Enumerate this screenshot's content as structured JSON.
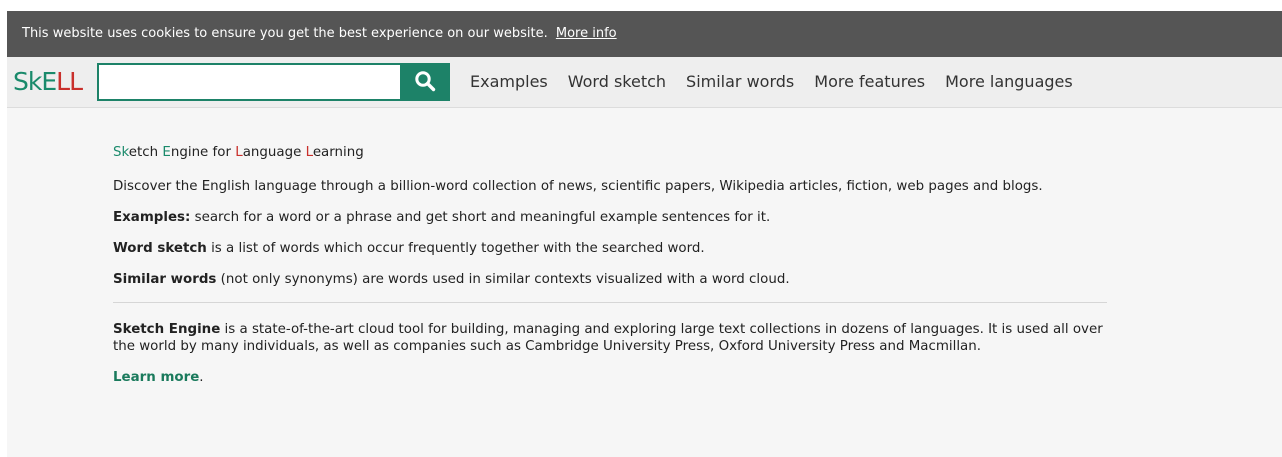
{
  "cookie_bar": {
    "message": "This website uses cookies to ensure you get the best experience on our website.",
    "more_info_label": "More info"
  },
  "header": {
    "logo": {
      "s": "S",
      "k": "k",
      "e": "E",
      "l1": "L",
      "l2": "L"
    },
    "search": {
      "value": "",
      "placeholder": ""
    },
    "search_button_icon": "search-icon",
    "nav": [
      {
        "label": "Examples"
      },
      {
        "label": "Word sketch"
      },
      {
        "label": "Similar words"
      },
      {
        "label": "More features"
      },
      {
        "label": "More languages"
      }
    ]
  },
  "main": {
    "tagline": {
      "w1_initial": "Sk",
      "w1_rest": "etch ",
      "w2_initial": "E",
      "w2_rest": "ngine for ",
      "w3_initial": "L",
      "w3_rest": "anguage ",
      "w4_initial": "L",
      "w4_rest": "earning"
    },
    "intro": "Discover the English language through a billion-word collection of news, scientific papers, Wikipedia articles, fiction, web pages and blogs.",
    "examples_term": "Examples:",
    "examples_desc": " search for a word or a phrase and get short and meaningful example sentences for it.",
    "word_sketch_term": "Word sketch",
    "word_sketch_desc": " is a list of words which occur frequently together with the searched word.",
    "similar_words_term": "Similar words",
    "similar_words_desc": " (not only synonyms) are words used in similar contexts visualized with a word cloud.",
    "sketch_engine_term": "Sketch Engine",
    "sketch_engine_desc": " is a state-of-the-art cloud tool for building, managing and exploring large text collections in dozens of languages. It is used all over the world by many individuals, as well as companies such as Cambridge University Press, Oxford University Press and Macmillan.",
    "learn_more_label": "Learn more",
    "learn_more_suffix": "."
  },
  "colors": {
    "brand_green": "#1d8268",
    "brand_red": "#c9302c",
    "cookie_bg": "#555555"
  }
}
